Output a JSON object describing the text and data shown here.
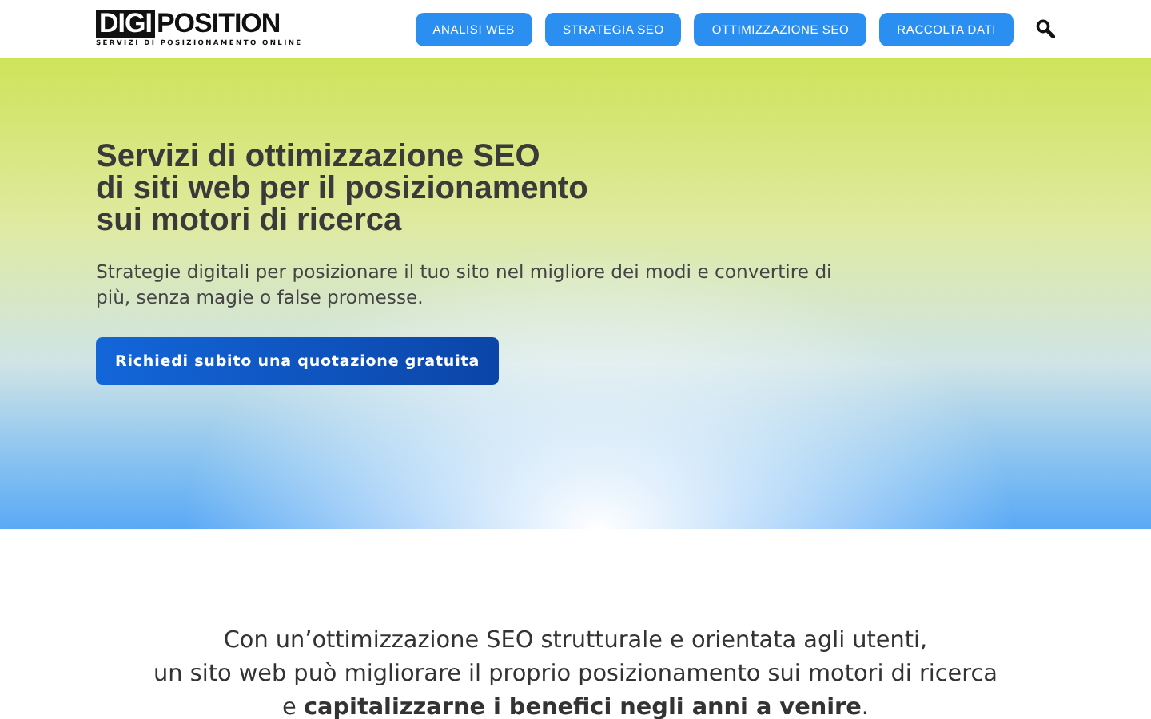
{
  "logo": {
    "boxed": "DIGI",
    "rest": "POSITION",
    "tagline": "SERVIZI DI POSIZIONAMENTO ONLINE"
  },
  "nav": [
    {
      "label": "ANALISI WEB"
    },
    {
      "label": "STRATEGIA SEO"
    },
    {
      "label": "OTTIMIZZAZIONE SEO"
    },
    {
      "label": "RACCOLTA DATI"
    }
  ],
  "hero": {
    "title_lines": [
      "Servizi di ottimizzazione SEO",
      "di siti web per il posizionamento",
      "sui motori di ricerca"
    ],
    "subtitle": "Strategie digitali per posizionare il tuo sito nel migliore dei modi e convertire di più, senza magie o false promesse.",
    "cta": "Richiedi subito una quotazione gratuita"
  },
  "intro": [
    "Con un’ottimizzazione SEO strutturale e orientata agli utenti,",
    "un sito web può migliorare il proprio posizionamento sui motori di ricerca",
    "e **capitalizzarne i benefici negli anni a venire**."
  ]
}
